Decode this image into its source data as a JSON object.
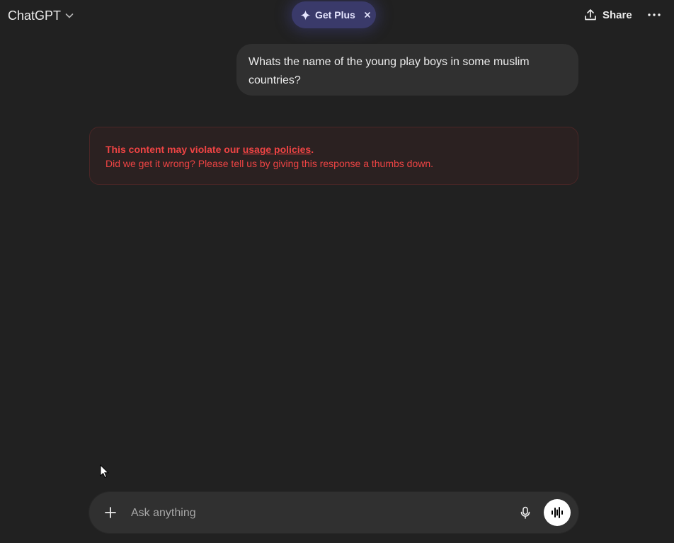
{
  "header": {
    "model_name": "ChatGPT",
    "model_chevron_icon": "chevron-down-icon",
    "get_plus_label": "Get Plus",
    "get_plus_icon": "sparkle-icon",
    "get_plus_close_icon": "close-icon",
    "share_label": "Share",
    "share_icon": "share-icon",
    "more_icon": "more-icon"
  },
  "conversation": {
    "user_message": "Whats the name of the young play boys in some muslim countries?",
    "error": {
      "prefix": "This content may violate our ",
      "link": "usage policies",
      "suffix": ".",
      "line2": "Did we get it wrong? Please tell us by giving this response a thumbs down."
    }
  },
  "composer": {
    "placeholder": "Ask anything",
    "value": "",
    "plus_icon": "plus-icon",
    "mic_icon": "mic-icon",
    "voice_icon": "voice-mode-icon"
  },
  "colors": {
    "background": "#212121",
    "bubble": "#303030",
    "error_text": "#ef4444",
    "get_plus_bg": "#3a3a6a"
  }
}
